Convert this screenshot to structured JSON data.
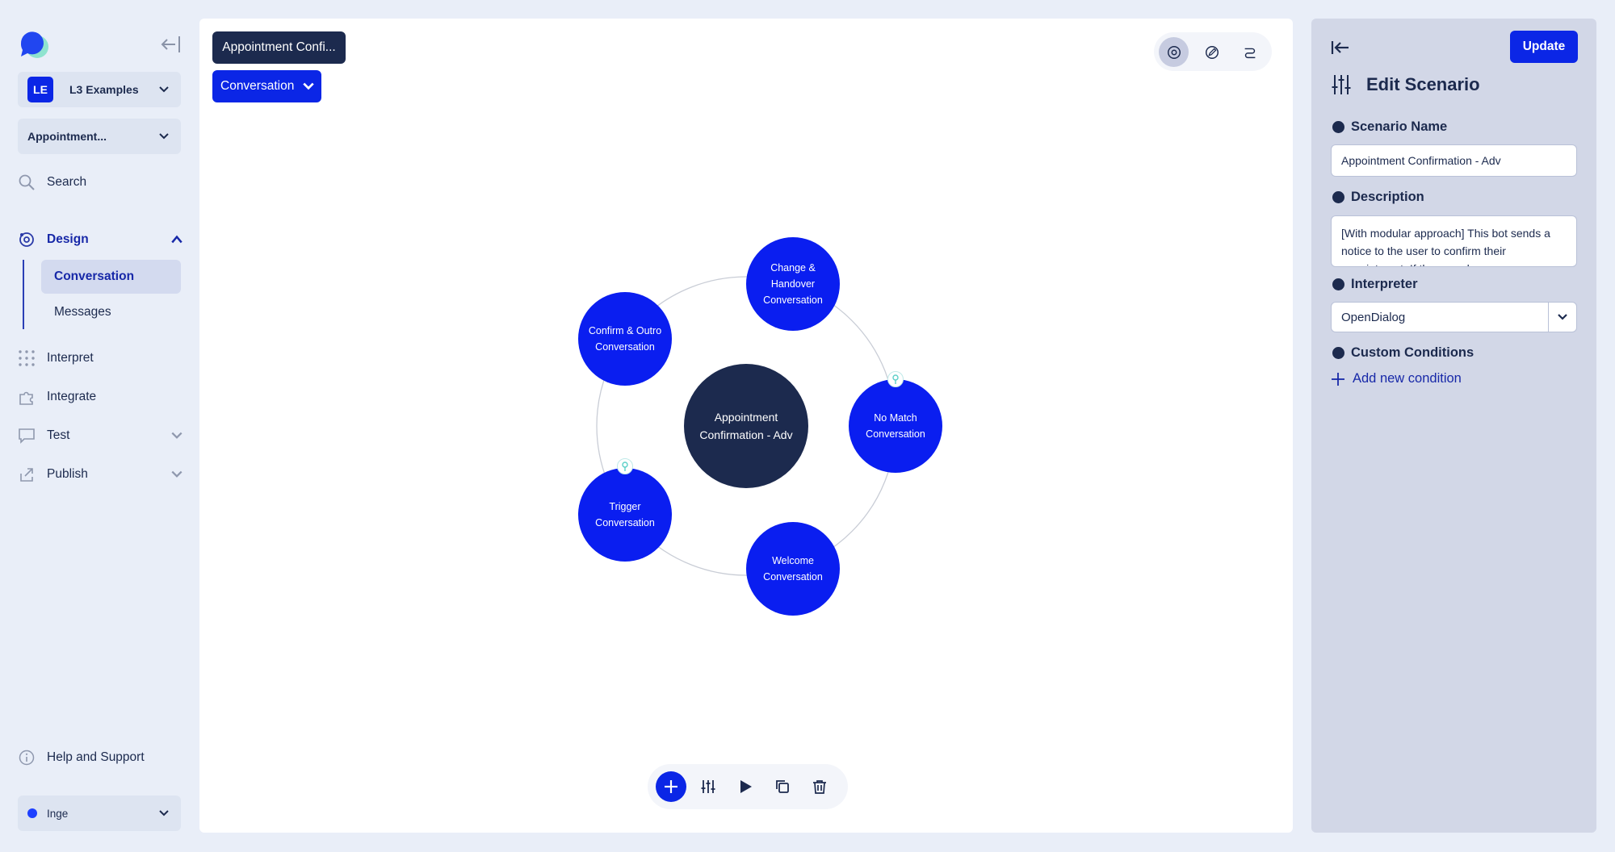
{
  "sidebar": {
    "workspace": {
      "badge": "LE",
      "name": "L3 Examples"
    },
    "scenario_select": "Appointment...",
    "nav": {
      "search": "Search",
      "design": "Design",
      "design_sub": [
        "Conversation",
        "Messages"
      ],
      "interpret": "Interpret",
      "integrate": "Integrate",
      "test": "Test",
      "publish": "Publish",
      "help": "Help and Support"
    },
    "user": "Inge"
  },
  "canvas": {
    "breadcrumb": "Appointment Confi...",
    "level_select": "Conversation",
    "center_node": [
      "Appointment",
      "Confirmation - Adv"
    ],
    "nodes": [
      {
        "name": "change-handover",
        "lines": [
          "Change &",
          "Handover",
          "Conversation"
        ]
      },
      {
        "name": "no-match",
        "lines": [
          "No Match",
          "Conversation"
        ]
      },
      {
        "name": "welcome",
        "lines": [
          "Welcome",
          "Conversation"
        ]
      },
      {
        "name": "trigger",
        "lines": [
          "Trigger",
          "Conversation"
        ]
      },
      {
        "name": "confirm-outro",
        "lines": [
          "Confirm & Outro",
          "Conversation"
        ]
      }
    ]
  },
  "panel": {
    "update_label": "Update",
    "title": "Edit Scenario",
    "scenario_name_label": "Scenario Name",
    "scenario_name_value": "Appointment Confirmation - Adv",
    "description_label": "Description",
    "description_value": "[With modular approach] This bot sends a notice to the user to confirm their appointment. If the user doesn",
    "interpreter_label": "Interpreter",
    "interpreter_value": "OpenDialog",
    "custom_conditions_label": "Custom Conditions",
    "add_condition": "Add new condition"
  },
  "colors": {
    "brand_blue": "#0b26e6",
    "navy": "#1c2a4e",
    "annotation_arrow": "#ef5a4a"
  }
}
